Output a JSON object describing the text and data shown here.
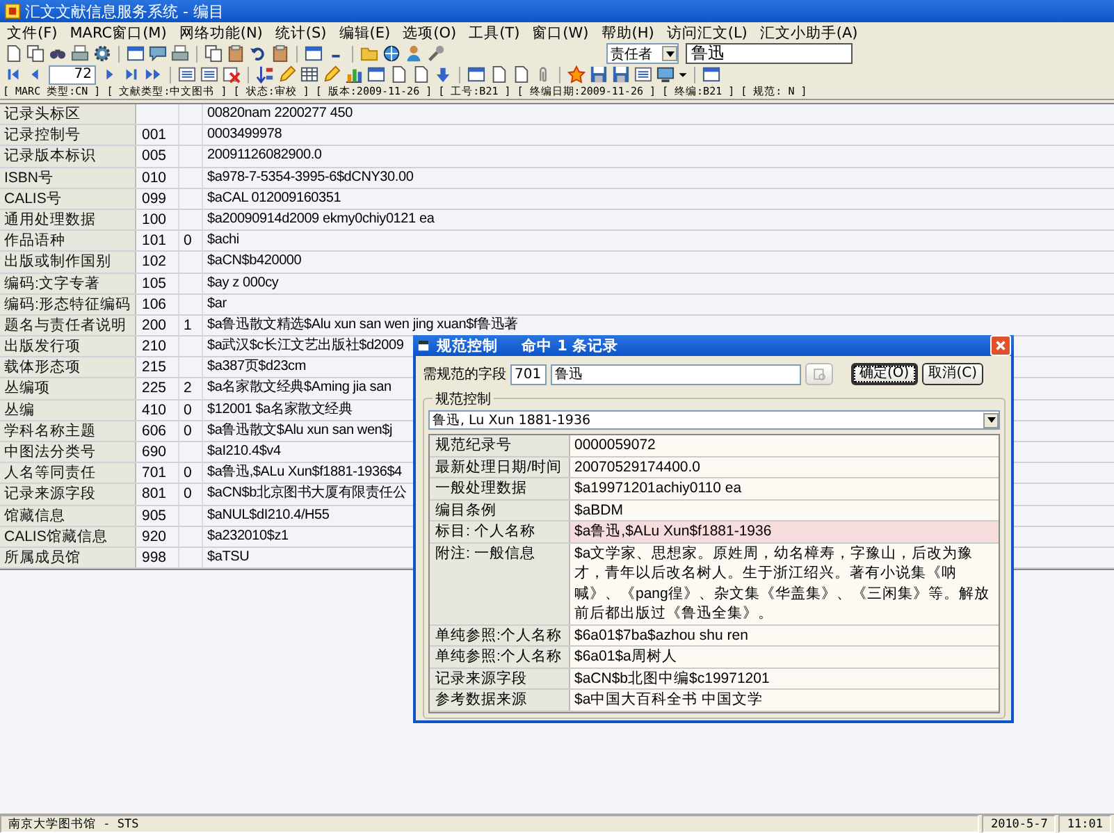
{
  "window": {
    "title": "汇文文献信息服务系统 - 编目"
  },
  "menu": [
    "文件(F)",
    "MARC窗口(M)",
    "网络功能(N)",
    "统计(S)",
    "编辑(E)",
    "选项(O)",
    "工具(T)",
    "窗口(W)",
    "帮助(H)",
    "访问汇文(L)",
    "汇文小助手(A)"
  ],
  "search": {
    "field": "责任者",
    "value": "鲁迅"
  },
  "navigator": {
    "record": "72"
  },
  "info_line": "[ MARC 类型:CN ] [ 文献类型:中文图书 ] [ 状态:审校 ] [ 版本:2009-11-26 ] [ 工号:B21 ] [ 终编日期:2009-11-26 ] [ 终编:B21 ] [ 规范: N ]",
  "marc_rows": [
    {
      "label": "记录头标区",
      "value": "00820nam  2200277   450"
    },
    {
      "label": "记录控制号",
      "tag": "001",
      "value": "0003499978"
    },
    {
      "label": "记录版本标识",
      "tag": "005",
      "value": "20091126082900.0"
    },
    {
      "label": "ISBN号",
      "tag": "010",
      "value": "$a978-7-5354-3995-6$dCNY30.00"
    },
    {
      "label": "CALIS号",
      "tag": "099",
      "value": "$aCAL 012009160351"
    },
    {
      "label": "通用处理数据",
      "tag": "100",
      "value": "$a20090914d2009    ekmy0chiy0121    ea"
    },
    {
      "label": "作品语种",
      "tag": "101",
      "indicator": "0",
      "value": "$achi"
    },
    {
      "label": "出版或制作国别",
      "tag": "102",
      "value": "$aCN$b420000"
    },
    {
      "label": "编码:文字专著",
      "tag": "105",
      "value": "$ay   z   000cy"
    },
    {
      "label": "编码:形态特征编码",
      "tag": "106",
      "value": "$ar"
    },
    {
      "label": "题名与责任者说明",
      "tag": "200",
      "indicator": "1",
      "value": "$a鲁迅散文精选$Alu xun san wen jing xuan$f鲁迅著"
    },
    {
      "label": "出版发行项",
      "tag": "210",
      "value": "$a武汉$c长江文艺出版社$d2009"
    },
    {
      "label": "载体形态项",
      "tag": "215",
      "value": "$a387页$d23cm"
    },
    {
      "label": "丛编项",
      "tag": "225",
      "indicator": "2",
      "value": "$a名家散文经典$Aming jia san"
    },
    {
      "label": "丛编",
      "tag": "410",
      "indicator": "0",
      "value": "$12001 $a名家散文经典"
    },
    {
      "label": "学科名称主题",
      "tag": "606",
      "indicator": "0",
      "value": "$a鲁迅散文$Alu xun san wen$j"
    },
    {
      "label": "中图法分类号",
      "tag": "690",
      "value": "$aI210.4$v4"
    },
    {
      "label": "人名等同责任",
      "tag": "701",
      "indicator": "0",
      "value": "$a鲁迅,$ALu Xun$f1881-1936$4"
    },
    {
      "label": "记录来源字段",
      "tag": "801",
      "indicator": "0",
      "value": "$aCN$b北京图书大厦有限责任公"
    },
    {
      "label": "馆藏信息",
      "tag": "905",
      "value": "$aNUL$dI210.4/H55"
    },
    {
      "label": "CALIS馆藏信息",
      "tag": "920",
      "value": "$a232010$z1"
    },
    {
      "label": "所属成员馆",
      "tag": "998",
      "value": "$aTSU"
    }
  ],
  "dialog": {
    "title": "规范控制",
    "hits": "命中 1 条记录",
    "field_label": "需规范的字段",
    "field_tag": "701",
    "field_value": "鲁迅",
    "search_button": {
      "disabled": true
    },
    "ok_button": "确定(O)",
    "cancel_button": "取消(C)",
    "group_label": "规范控制",
    "heading_choice": "鲁迅, Lu Xun 1881-1936",
    "rows": [
      {
        "label": "规范纪录号",
        "value": "0000059072",
        "selected": false
      },
      {
        "label": "最新处理日期/时间",
        "value": "20070529174400.0",
        "selected": false
      },
      {
        "label": "一般处理数据",
        "value": "$a19971201achiy0110    ea",
        "selected": false
      },
      {
        "label": "编目条例",
        "value": "$aBDM",
        "selected": false
      },
      {
        "label": "标目: 个人名称",
        "value": "$a鲁迅,$ALu Xun$f1881-1936",
        "selected": true
      },
      {
        "label": "附注: 一般信息",
        "value": "$a文学家、思想家。原姓周，幼名樟寿，字豫山，后改为豫才，青年以后改名树人。生于浙江绍兴。著有小说集《呐喊》、《pang徨》、杂文集《华盖集》、《三闲集》等。解放前后都出版过《鲁迅全集》。",
        "selected": false
      },
      {
        "label": "单纯参照:个人名称",
        "value": "$6a01$7ba$azhou shu ren",
        "selected": false
      },
      {
        "label": "单纯参照:个人名称",
        "value": "$6a01$a周树人",
        "selected": false
      },
      {
        "label": "记录来源字段",
        "value": "$aCN$b北图中编$c19971201",
        "selected": false
      },
      {
        "label": "参考数据来源",
        "value": "$a中国大百科全书  中国文学",
        "selected": false
      }
    ]
  },
  "status_bar": {
    "library": "南京大学图书馆 - STS",
    "date": "2010-5-7",
    "time": "11:01"
  }
}
